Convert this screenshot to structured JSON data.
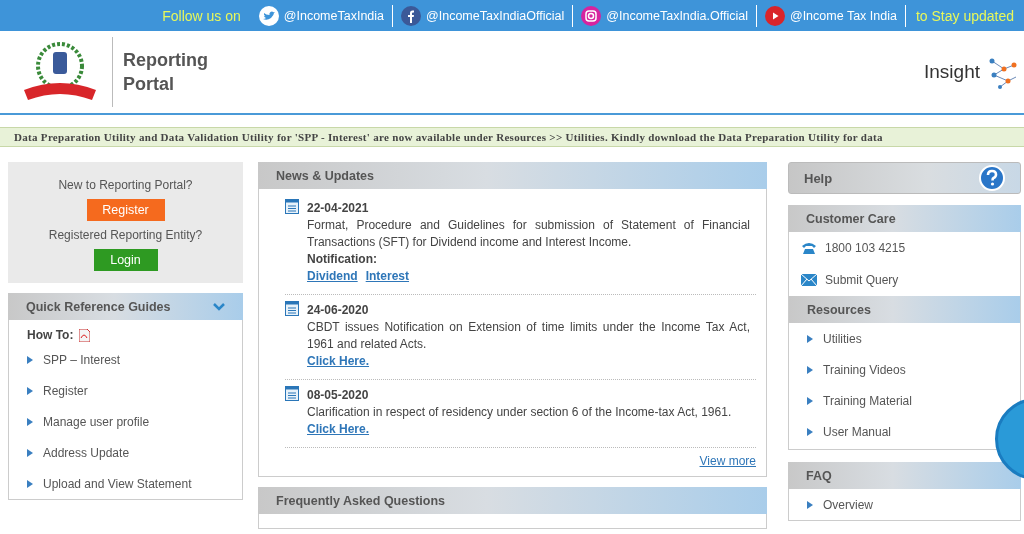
{
  "social_bar": {
    "lead": "Follow us on",
    "accounts": [
      {
        "kind": "twitter",
        "handle": "@IncomeTaxIndia"
      },
      {
        "kind": "facebook",
        "handle": "@IncomeTaxIndiaOfficial"
      },
      {
        "kind": "instagram",
        "handle": "@IncomeTaxIndia.Official"
      },
      {
        "kind": "youtube",
        "handle": "@Income Tax India"
      }
    ],
    "tail": "to Stay updated"
  },
  "header": {
    "portal_title": [
      "Reporting",
      "Portal"
    ],
    "brand": "Insight"
  },
  "ticker": "Data Preparation Utility and Data Validation Utility for 'SPP - Interest' are now available under Resources >> Utilities. Kindly download the Data Preparation Utility for data",
  "login_panel": {
    "new_prompt": "New to Reporting Portal?",
    "register_label": "Register",
    "registered_prompt": "Registered Reporting Entity?",
    "login_label": "Login"
  },
  "quick_reference": {
    "title": "Quick Reference Guides",
    "expanded": true,
    "how_to": "How To:",
    "items": [
      "SPP – Interest",
      "Register",
      "Manage user profile",
      "Address Update",
      "Upload and View Statement"
    ]
  },
  "news": {
    "title": "News & Updates",
    "items": [
      {
        "date": "22-04-2021",
        "text": "Format, Procedure and Guidelines for submission of Statement of Financial Transactions (SFT) for Dividend income and Interest Income.",
        "note": "Notification:",
        "links": [
          "Dividend",
          "Interest"
        ]
      },
      {
        "date": "24-06-2020",
        "text": "CBDT issues Notification on Extension of time limits under the Income Tax Act, 1961 and related Acts.",
        "links": [
          "Click Here."
        ]
      },
      {
        "date": "08-05-2020",
        "text": "Clarification in respect of residency under section 6 of the Income-tax Act, 1961.",
        "links": [
          "Click Here."
        ]
      }
    ],
    "view_more": "View more"
  },
  "faq_panel": {
    "title": "Frequently Asked Questions"
  },
  "help": {
    "title": "Help"
  },
  "customer_care": {
    "title": "Customer Care",
    "items": [
      {
        "kind": "phone",
        "label": "1800 103 4215"
      },
      {
        "kind": "mail",
        "label": "Submit Query"
      }
    ]
  },
  "resources": {
    "title": "Resources",
    "items": [
      "Utilities",
      "Training Videos",
      "Training Material",
      "User Manual"
    ]
  },
  "faq": {
    "title": "FAQ",
    "items": [
      "Overview"
    ]
  }
}
